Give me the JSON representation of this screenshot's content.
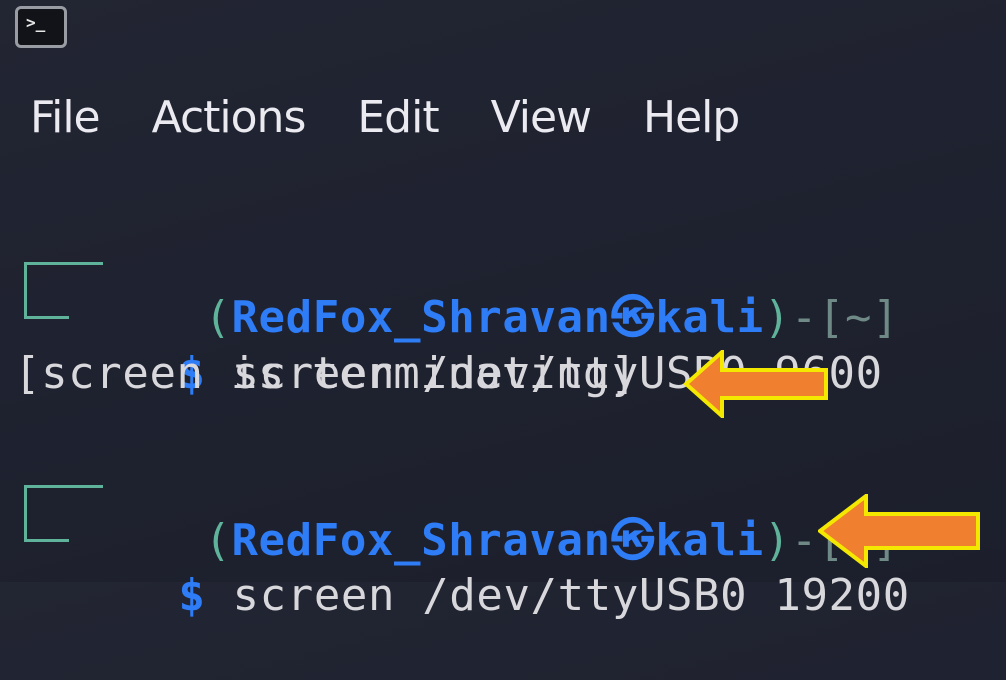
{
  "window": {
    "icon": "terminal-icon",
    "icon_glyph": ">_"
  },
  "menubar": {
    "items": [
      "File",
      "Actions",
      "Edit",
      "View",
      "Help"
    ]
  },
  "terminal": {
    "prompts": [
      {
        "open_paren": "(",
        "user": "RedFox_Shravan",
        "at_symbol": "㉿",
        "host": "kali",
        "close_paren": ")",
        "dir_segment": "-[~]",
        "dollar": "$",
        "command": " screen /dev/ttyUSB0 9600"
      },
      {
        "open_paren": "(",
        "user": "RedFox_Shravan",
        "at_symbol": "㉿",
        "host": "kali",
        "close_paren": ")",
        "dir_segment": "-[~]",
        "dollar": "$",
        "command": " screen /dev/ttyUSB0 19200"
      }
    ],
    "output_lines": [
      "[screen is terminating]"
    ]
  },
  "annotations": {
    "arrow_color": "#f08030",
    "arrow_outline": "#f5e800",
    "arrows": [
      "arrow-pointing-to-terminating-message",
      "arrow-pointing-to-19200-command"
    ]
  }
}
